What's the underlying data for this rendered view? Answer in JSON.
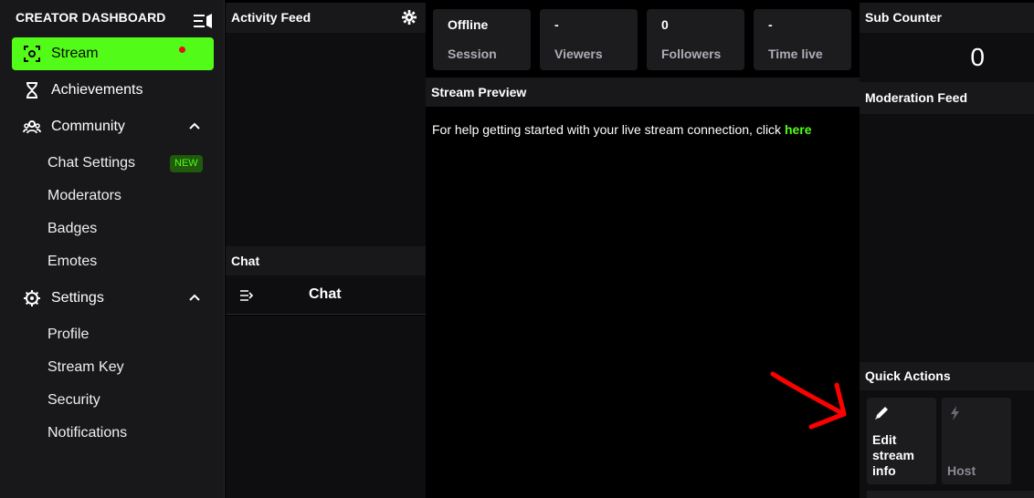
{
  "sidebar": {
    "title": "CREATOR DASHBOARD",
    "items": {
      "stream": "Stream",
      "achievements": "Achievements",
      "community": "Community",
      "settings": "Settings"
    },
    "community_sub": [
      "Chat Settings",
      "Moderators",
      "Badges",
      "Emotes"
    ],
    "settings_sub": [
      "Profile",
      "Stream Key",
      "Security",
      "Notifications"
    ],
    "new_badge": "NEW"
  },
  "activity_feed": {
    "title": "Activity Feed"
  },
  "chat_panel": {
    "title": "Chat",
    "header": "Chat"
  },
  "stats": [
    {
      "value": "Offline",
      "label": "Session"
    },
    {
      "value": "-",
      "label": "Viewers"
    },
    {
      "value": "0",
      "label": "Followers"
    },
    {
      "value": "-",
      "label": "Time live"
    }
  ],
  "stream_preview": {
    "title": "Stream Preview",
    "help_text": "For help getting started with your live stream connection, click ",
    "help_link": "here"
  },
  "sub_counter": {
    "title": "Sub Counter",
    "value": "0"
  },
  "moderation_feed": {
    "title": "Moderation Feed"
  },
  "quick_actions": {
    "title": "Quick Actions",
    "edit_label": "Edit\nstream\ninfo",
    "host_label": "Host"
  },
  "colors": {
    "accent": "#53fc18",
    "annotation": "#ff0000"
  }
}
